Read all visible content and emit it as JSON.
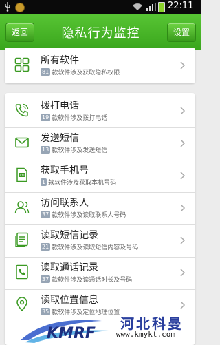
{
  "status_bar": {
    "time": "22:11"
  },
  "header": {
    "back_label": "返回",
    "title": "隐私行为监控",
    "settings_label": "设置"
  },
  "all_software": {
    "title": "所有软件",
    "count": "81",
    "desc": "款软件涉及获取隐私权限",
    "icon": "grid-icon"
  },
  "items": [
    {
      "title": "拨打电话",
      "count": "19",
      "desc": "款软件涉及拨打电话",
      "icon": "phone-icon"
    },
    {
      "title": "发送短信",
      "count": "13",
      "desc": "款软件涉及发送短信",
      "icon": "envelope-icon"
    },
    {
      "title": "获取手机号",
      "count": "1",
      "desc": "款软件涉及获取本机号码",
      "icon": "sim-card-icon"
    },
    {
      "title": "访问联系人",
      "count": "37",
      "desc": "款软件涉及读取联系人号码",
      "icon": "contact-icon"
    },
    {
      "title": "读取短信记录",
      "count": "21",
      "desc": "款软件涉及读取短信内容及号码",
      "icon": "sms-log-icon"
    },
    {
      "title": "读取通话记录",
      "count": "37",
      "desc": "款软件涉及读通话时长及号码",
      "icon": "call-log-icon"
    },
    {
      "title": "读取位置信息",
      "count": "35",
      "desc": "款软件涉及定位地理位置",
      "icon": "location-pin-icon"
    }
  ],
  "watermark": {
    "logo_text": "KMRF",
    "name": "河北科曼",
    "url": "www.kmykt.com"
  },
  "colors": {
    "accent": "#3aa61d",
    "icon": "#3b9a23",
    "badge": "#97a5b5"
  }
}
